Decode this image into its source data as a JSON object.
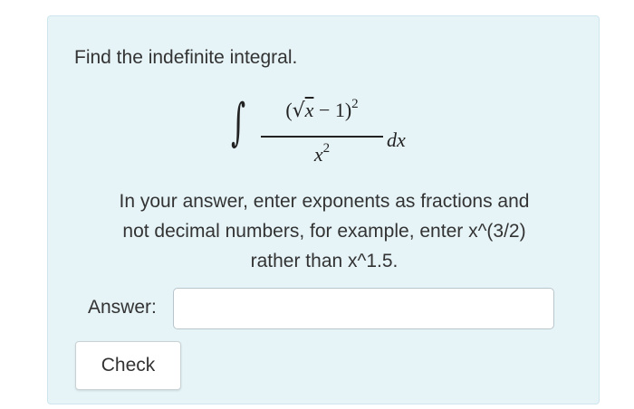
{
  "question": {
    "prompt": "Find the indefinite integral.",
    "integral": {
      "sign": "∫",
      "numerator_open": "(",
      "sqrt_symbol": "√",
      "radicand": "x",
      "numerator_rest": " − 1)",
      "numerator_exponent": "2",
      "denominator_base": "x",
      "denominator_exponent": "2",
      "differential": "dx"
    },
    "instructions_line1": "In your answer, enter exponents as fractions and",
    "instructions_line2": "not decimal numbers, for example, enter x^(3/2)",
    "instructions_line3": "rather than x^1.5."
  },
  "answer": {
    "label": "Answer:",
    "value": "",
    "placeholder": ""
  },
  "actions": {
    "check_label": "Check"
  },
  "colors": {
    "card_background": "#e6f4f8",
    "card_border": "#cfe6ee",
    "text": "#333333"
  }
}
